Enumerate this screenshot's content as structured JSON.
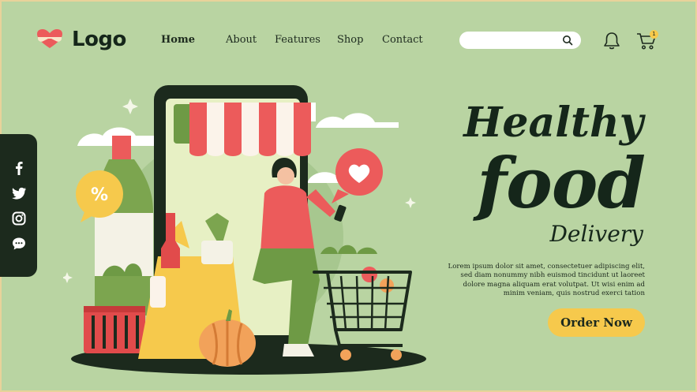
{
  "brand": {
    "logo_text": "Logo",
    "logo_icon": "heart-glasses-icon"
  },
  "nav": {
    "items": [
      {
        "label": "Home",
        "active": true
      },
      {
        "label": "About",
        "active": false
      },
      {
        "label": "Features",
        "active": false
      },
      {
        "label": "Shop",
        "active": false
      },
      {
        "label": "Contact",
        "active": false
      }
    ]
  },
  "search": {
    "placeholder": "",
    "icon": "search-icon"
  },
  "header_icons": {
    "bell": "bell-icon",
    "cart": "cart-icon",
    "cart_count": "1"
  },
  "social": {
    "items": [
      "facebook-icon",
      "twitter-icon",
      "instagram-icon",
      "chat-icon"
    ]
  },
  "hero": {
    "title_line1": "Healthy",
    "title_line2": "food",
    "title_line3": "Delivery",
    "description": "Lorem ipsum dolor sit amet, consectetuer adipiscing elit, sed diam nonummy nibh euismod tincidunt ut laoreet dolore magna aliquam erat volutpat. Ut wisi enim ad minim veniam, quis nostrud exerci tation",
    "cta_label": "Order Now"
  },
  "colors": {
    "background": "#b9d4a2",
    "dark": "#15261a",
    "accent_red": "#ec5b5b",
    "accent_yellow": "#f6c94c",
    "green": "#6e9a45"
  }
}
